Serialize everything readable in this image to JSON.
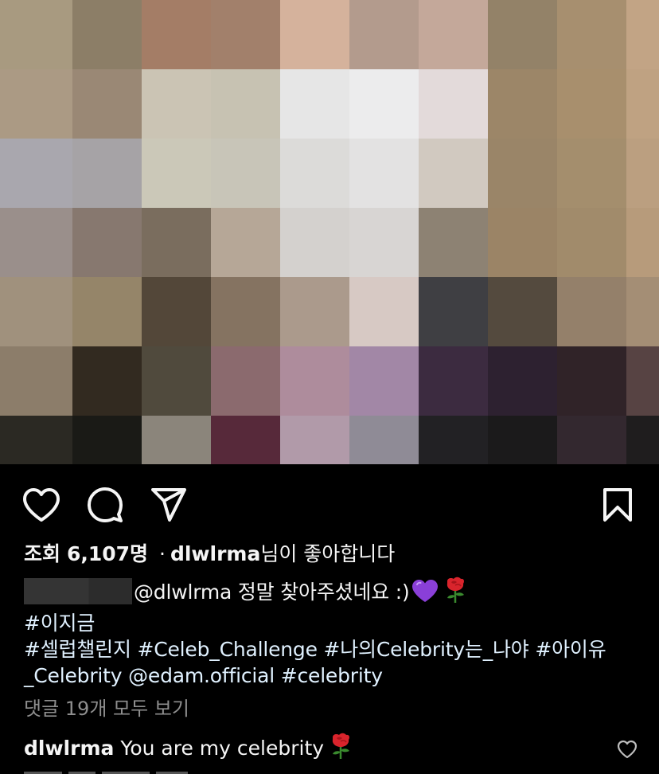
{
  "post": {
    "media": {
      "description_icon": "pixelated-photo",
      "colors": [
        [
          "#a89a80",
          "#8c7e67",
          "#a47d66",
          "#a2806b",
          "#d5b29c",
          "#b39b8d",
          "#c4a89a",
          "#938268",
          "#a78f6f",
          "#c2a485"
        ],
        [
          "#ab9a84",
          "#9a8875",
          "#cbc4b4",
          "#c7c2b2",
          "#e6e6e6",
          "#ececed",
          "#e3dada",
          "#9c8668",
          "#a88f6d",
          "#bfa282"
        ],
        [
          "#a9a7ae",
          "#a6a3a6",
          "#cbc8b8",
          "#c8c5b8",
          "#dcdbd9",
          "#e3e2e2",
          "#d1c9c0",
          "#9a8568",
          "#a48e6d",
          "#bb9f80"
        ],
        [
          "#9a8f8b",
          "#87786f",
          "#7a6d5e",
          "#b6a797",
          "#d4d1ce",
          "#d8d5d3",
          "#8d8273",
          "#9b8466",
          "#a18b6b",
          "#b79b7b"
        ],
        [
          "#a0917d",
          "#958569",
          "#534739",
          "#857361",
          "#ab9a8c",
          "#d7c9c4",
          "#3f3f43",
          "#544a3e",
          "#94806a",
          "#a48e75"
        ],
        [
          "#8c7d6a",
          "#322a20",
          "#504a3d",
          "#8b6a6e",
          "#ae8c9c",
          "#a287a6",
          "#3c2b40",
          "#2d2130",
          "#302328",
          "#574343"
        ],
        [
          "#2b2923",
          "#1a1a16",
          "#8b857b",
          "#57293a",
          "#b19aa9",
          "#8f8b96",
          "#222124",
          "#1b1a1b",
          "#33282f",
          "#1f1d1e"
        ]
      ]
    },
    "actions": {
      "like_icon": "heart-icon",
      "comment_icon": "comment-icon",
      "share_icon": "send-icon",
      "save_icon": "bookmark-icon"
    },
    "likes": {
      "views_label": "조회",
      "views_count": "6,107명",
      "separator": "·",
      "liked_by_user": "dlwlrma",
      "liked_by_suffix": "님이 좋아합니다"
    },
    "caption": {
      "mention_text": "@dlwlrma 정말 찾아주셨네요 :)",
      "emoji_heart": "purple-heart",
      "emoji_rose": "rose",
      "line2": "#이지금",
      "line3": "#셀럽챌린지 #Celeb_Challenge #나의Celebrity는_나야 #아이유",
      "line4": "_Celebrity @edam.official #celebrity"
    },
    "view_comments": "댓글 19개 모두 보기",
    "comment": {
      "user": "dlwlrma",
      "text": "You are my celebrity",
      "emoji": "rose",
      "like_icon": "heart-small-icon"
    }
  }
}
